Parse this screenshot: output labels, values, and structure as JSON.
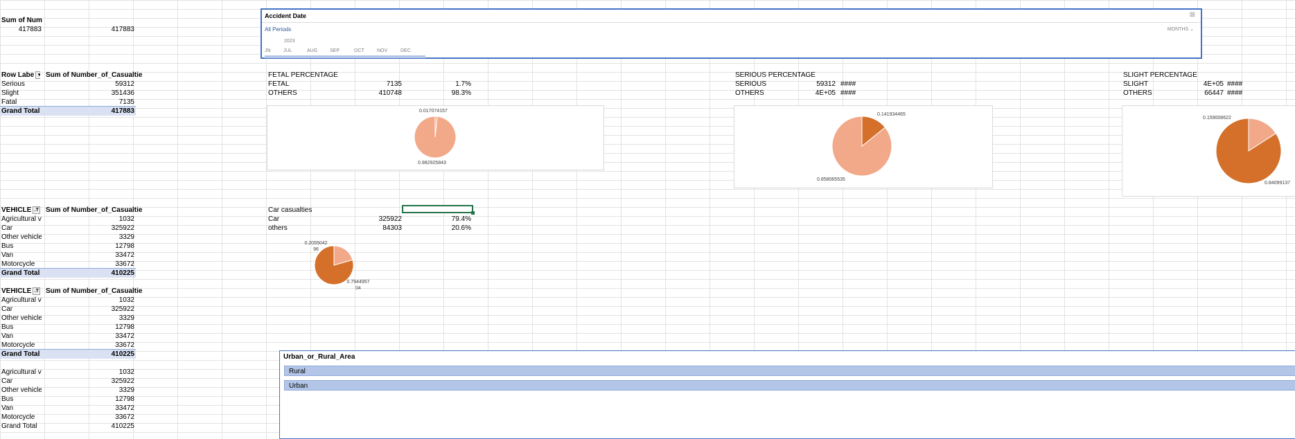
{
  "colors": {
    "pie_major": "#d4702a",
    "pie_minor": "#f2a98a",
    "accent": "#4472c4",
    "total_bg": "#d9e1f2"
  },
  "top_left": {
    "header": "Sum of Num",
    "value_a": "417883",
    "value_b": "417883"
  },
  "severity_pivot": {
    "header_a": "Row Labe",
    "header_b": "Sum of Number_of_Casualties",
    "rows": [
      {
        "label": "Serious",
        "value": "59312"
      },
      {
        "label": "Slight",
        "value": "351436"
      },
      {
        "label": "Fatal",
        "value": "7135"
      }
    ],
    "total_label": "Grand Total",
    "total_value": "417883"
  },
  "vehicle_pivot_1": {
    "header_a": "VEHICLE",
    "header_b": "Sum of Number_of_Casualties",
    "rows": [
      {
        "label": "Agricultural v",
        "value": "1032"
      },
      {
        "label": "Car",
        "value": "325922"
      },
      {
        "label": "Other vehicle",
        "value": "3329"
      },
      {
        "label": "Bus",
        "value": "12798"
      },
      {
        "label": "Van",
        "value": "33472"
      },
      {
        "label": "Motorcycle",
        "value": "33672"
      }
    ],
    "total_label": "Grand Total",
    "total_value": "410225"
  },
  "vehicle_pivot_2": {
    "header_a": "VEHICLE",
    "header_b": "Sum of Number_of_Casualties",
    "rows": [
      {
        "label": "Agricultural v",
        "value": "1032"
      },
      {
        "label": "Car",
        "value": "325922"
      },
      {
        "label": "Other vehicle",
        "value": "3329"
      },
      {
        "label": "Bus",
        "value": "12798"
      },
      {
        "label": "Van",
        "value": "33472"
      },
      {
        "label": "Motorcycle",
        "value": "33672"
      }
    ],
    "total_label": "Grand Total",
    "total_value": "410225"
  },
  "vehicle_list_3": {
    "rows": [
      {
        "label": "Agricultural v",
        "value": "1032"
      },
      {
        "label": "Car",
        "value": "325922"
      },
      {
        "label": "Other vehicle",
        "value": "3329"
      },
      {
        "label": "Bus",
        "value": "12798"
      },
      {
        "label": "Van",
        "value": "33472"
      },
      {
        "label": "Motorcycle",
        "value": "33672"
      }
    ],
    "total_label": "Grand Total",
    "total_value": "410225"
  },
  "fetal_table": {
    "title": "FETAL PERCENTAGE",
    "row1": {
      "label": "FETAL",
      "value": "7135",
      "pct": "1.7%"
    },
    "row2": {
      "label": "OTHERS",
      "value": "410748",
      "pct": "98.3%"
    }
  },
  "serious_table": {
    "title": "SERIOUS PERCENTAGE",
    "row1": {
      "label": "SERIOUS",
      "value": "59312",
      "pct": "####"
    },
    "row2": {
      "label": "OTHERS",
      "value": "4E+05",
      "pct": "####"
    }
  },
  "slight_table": {
    "title": "SLIGHT PERCENTAGE",
    "row1": {
      "label": "SLIGHT",
      "value": "4E+05",
      "pct": "####"
    },
    "row2": {
      "label": "OTHERS",
      "value": "66447",
      "pct": "####"
    }
  },
  "car_table": {
    "title": "Car casualties",
    "row1": {
      "label": "Car",
      "value": "325922",
      "pct": "79.4%"
    },
    "row2": {
      "label": "others",
      "value": "84303",
      "pct": "20.6%"
    }
  },
  "timeline": {
    "title": "Accident  Date",
    "all_periods": "All Periods",
    "level": "MONTHS",
    "year": "2023",
    "months": [
      "JN",
      "JUL",
      "AUG",
      "SEP",
      "OCT",
      "NOV",
      "DEC"
    ]
  },
  "slicer": {
    "title": "Urban_or_Rural_Area",
    "items": [
      "Rural",
      "Urban"
    ]
  },
  "chart_data": [
    {
      "type": "pie",
      "title": "",
      "labels": [
        "0.017074157",
        "0.982925843"
      ],
      "values": [
        0.017074157,
        0.982925843
      ]
    },
    {
      "type": "pie",
      "title": "",
      "labels": [
        "0.141934465",
        "0.858065535"
      ],
      "values": [
        0.141934465,
        0.858065535
      ]
    },
    {
      "type": "pie",
      "title": "",
      "labels": [
        "0.159008622",
        "0.84099137"
      ],
      "values": [
        0.159008622,
        0.84099137
      ]
    },
    {
      "type": "pie",
      "title": "",
      "labels": [
        "0.205504296",
        "0.794495704"
      ],
      "values": [
        0.205504296,
        0.794495704
      ]
    }
  ]
}
